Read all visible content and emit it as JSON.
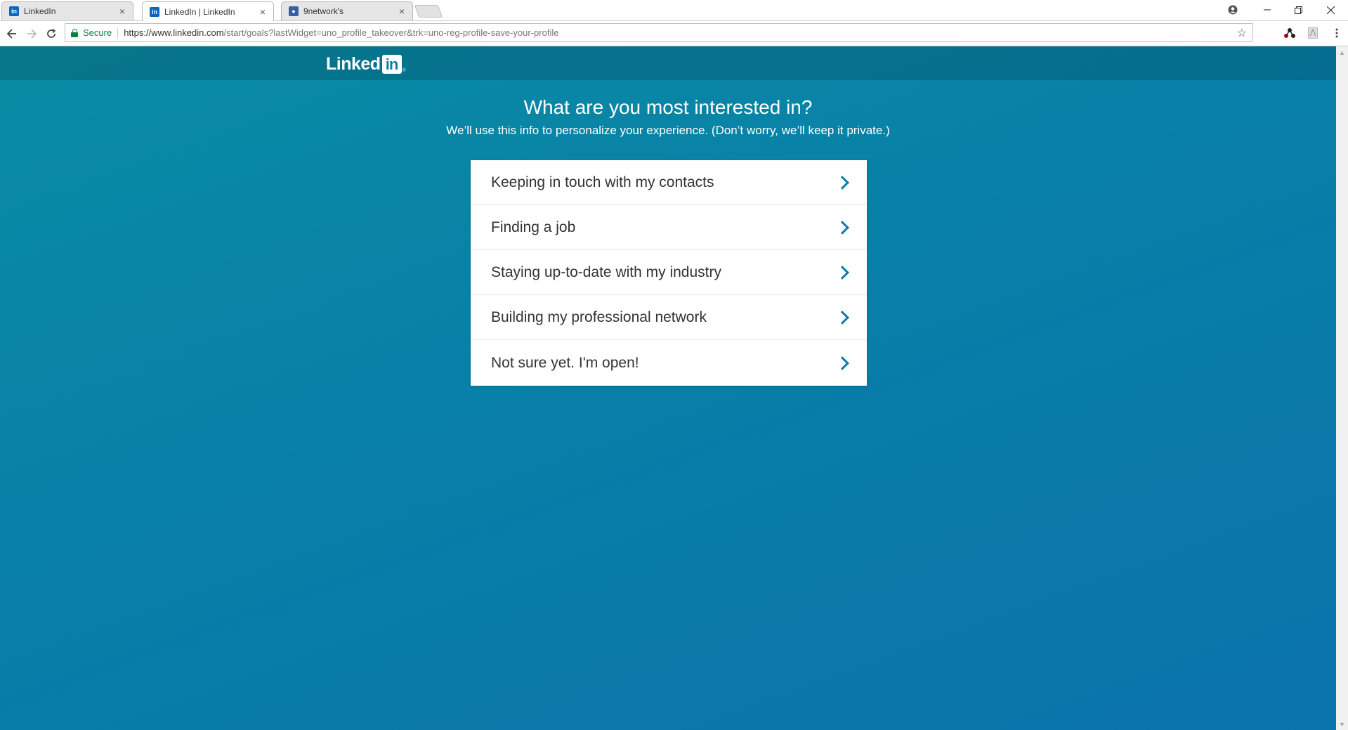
{
  "browser": {
    "tabs": [
      {
        "title": "LinkedIn",
        "favicon": "linkedin-icon",
        "active": false
      },
      {
        "title": "LinkedIn | LinkedIn",
        "favicon": "linkedin-icon",
        "active": true
      },
      {
        "title": "9network's",
        "favicon": "map-pin-icon",
        "active": false
      }
    ],
    "secure_label": "Secure",
    "url_host": "https://www.linkedin.com",
    "url_path": "/start/goals?lastWidget=uno_profile_takeover&trk=uno-reg-profile-save-your-profile"
  },
  "page": {
    "logo_text": "Linked",
    "logo_in": "in",
    "heading": "What are you most interested in?",
    "subheading": "We’ll use this info to personalize your experience. (Don’t worry, we’ll keep it private.)",
    "options": [
      {
        "label": "Keeping in touch with my contacts"
      },
      {
        "label": "Finding a job"
      },
      {
        "label": "Staying up-to-date with my industry"
      },
      {
        "label": "Building my professional network"
      },
      {
        "label": "Not sure yet. I'm open!"
      }
    ]
  },
  "colors": {
    "background_top": "#0a8ca4",
    "background_bottom": "#0b73ab",
    "chevron": "#0a7ea8",
    "secure": "#0b8043"
  }
}
